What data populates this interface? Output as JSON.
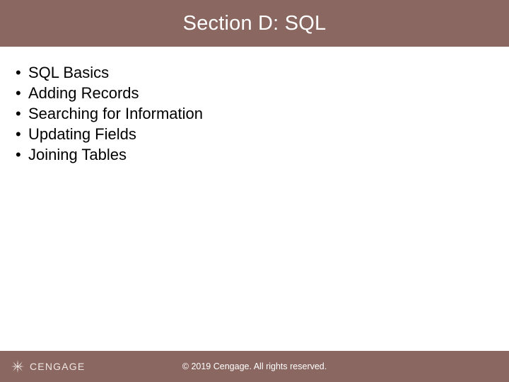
{
  "title": "Section D: SQL",
  "bullets": [
    "SQL Basics",
    "Adding Records",
    "Searching for Information",
    "Updating Fields",
    "Joining Tables"
  ],
  "footer": {
    "brand": "CENGAGE",
    "copyright": "© 2019 Cengage. All rights reserved."
  }
}
